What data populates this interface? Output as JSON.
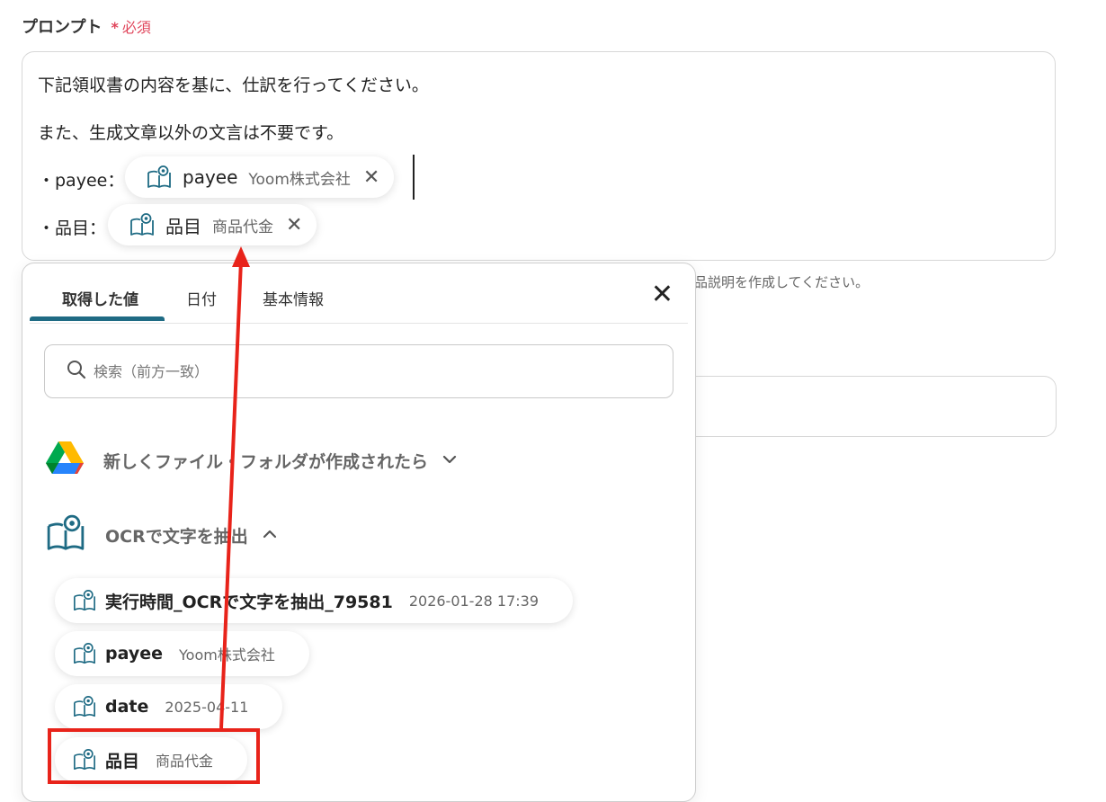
{
  "field": {
    "label": "プロンプト",
    "required_star": "*",
    "required_text": "必須"
  },
  "prompt": {
    "line1": "下記領収書の内容を基に、仕訳を行ってください。",
    "line2": "また、生成文章以外の文言は不要です。",
    "line3_prefix": "・payee：",
    "line4_prefix": "・品目：",
    "chip_payee": {
      "name": "payee",
      "value": "Yoom株式会社",
      "remove": "✕"
    },
    "chip_item": {
      "name": "品目",
      "value": "商品代金",
      "remove": "✕"
    }
  },
  "hint_text": "品説明を作成してください。",
  "popup": {
    "tabs": [
      {
        "label": "取得した値"
      },
      {
        "label": "日付"
      },
      {
        "label": "基本情報"
      }
    ],
    "close": "✕",
    "search_placeholder": "検索（前方一致）",
    "sections": [
      {
        "title": "新しくファイル・フォルダが作成されたら",
        "chevron": "⌄"
      },
      {
        "title": "OCRで文字を抽出",
        "chevron": "⌃"
      }
    ],
    "items": [
      {
        "name": "実行時間_OCRで文字を抽出_79581",
        "value": "2026-01-28 17:39"
      },
      {
        "name": "payee",
        "value": "Yoom株式会社"
      },
      {
        "name": "date",
        "value": "2025-04-11"
      },
      {
        "name": "品目",
        "value": "商品代金"
      }
    ]
  },
  "colors": {
    "accent": "#1f6b84",
    "required": "#e0455b",
    "annotation": "#e8231a"
  }
}
